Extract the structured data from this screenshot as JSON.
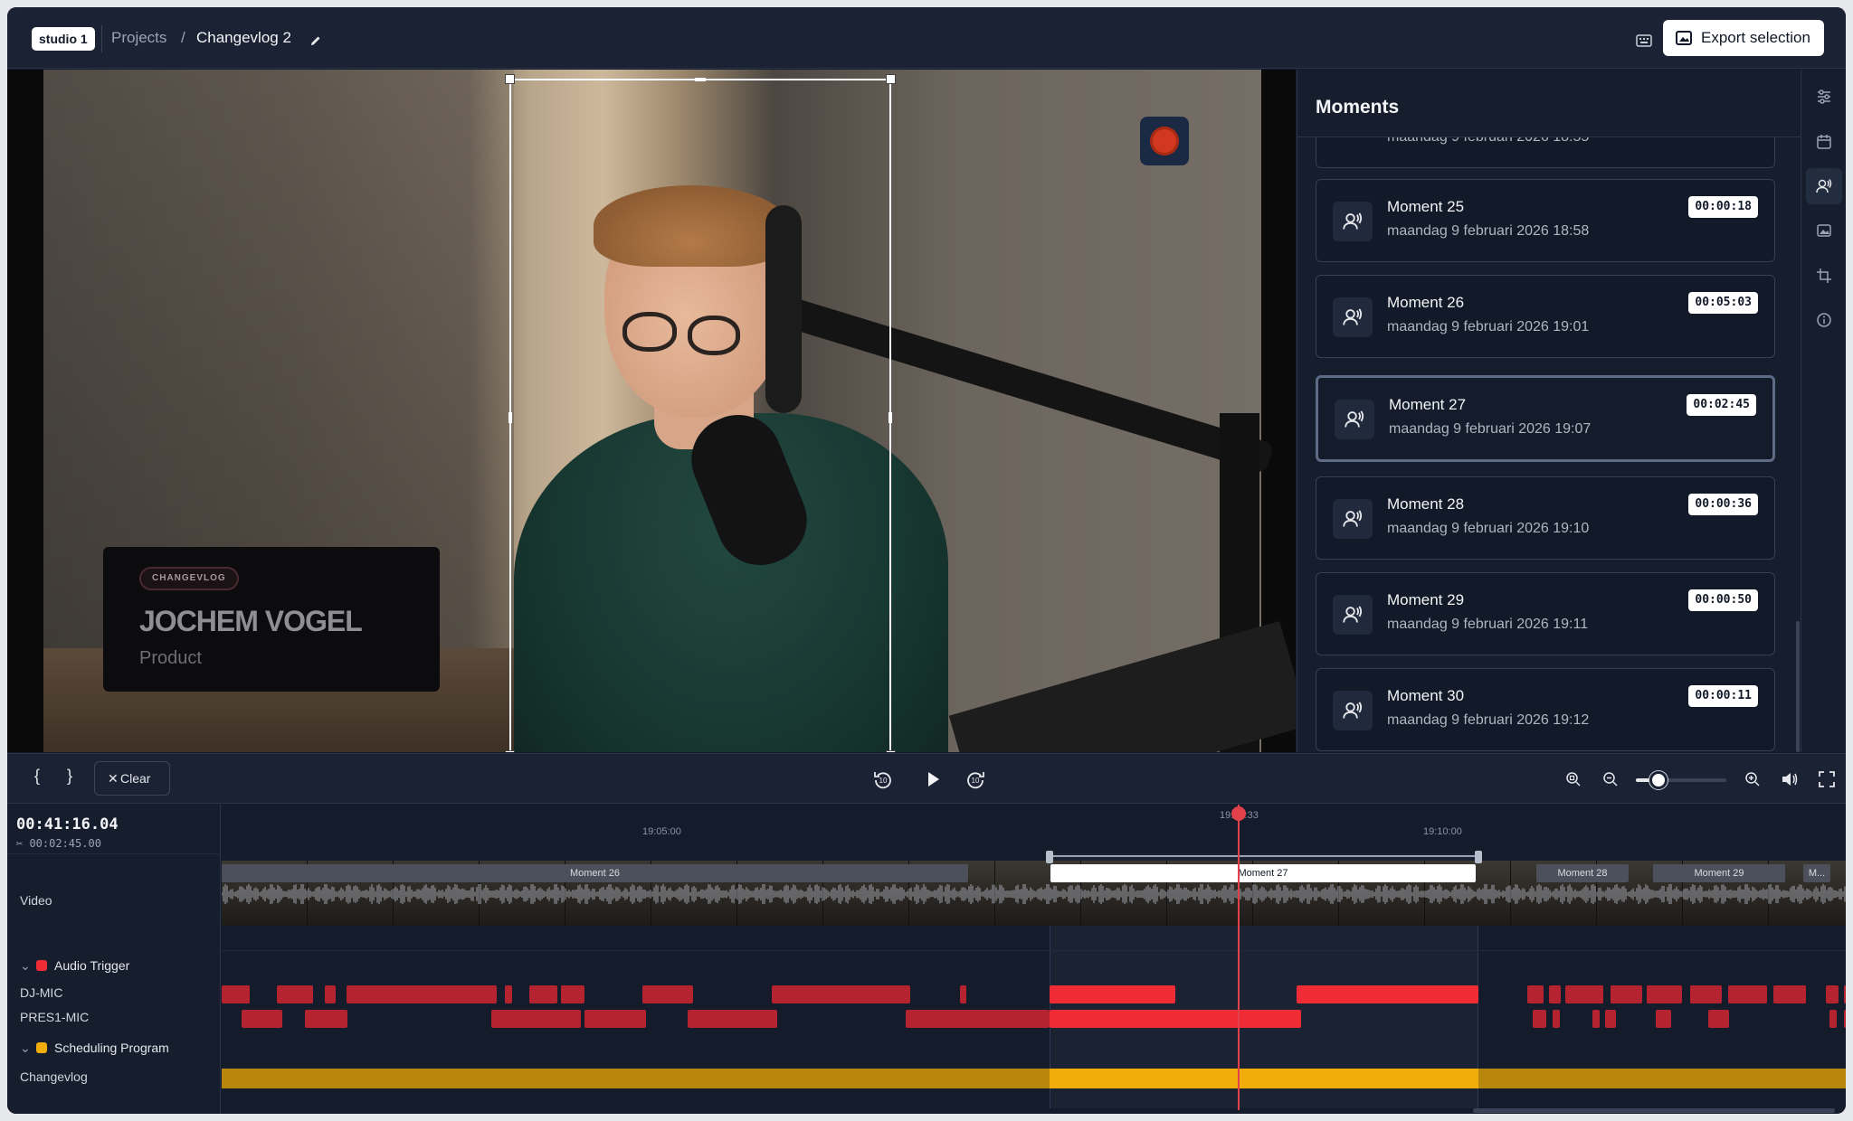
{
  "header": {
    "studio_badge": "studio 1",
    "breadcrumb_projects": "Projects",
    "breadcrumb_sep": "/",
    "breadcrumb_current": "Changevlog 2",
    "export_label": "Export selection"
  },
  "video": {
    "lower_third_tag": "CHANGEVLOG",
    "lower_third_name": "JOCHEM VOGEL",
    "lower_third_role": "Product"
  },
  "moments_panel": {
    "title": "Moments",
    "partial_top_date": "maandag 9 februari 2026 18:55",
    "items": [
      {
        "name": "Moment 25",
        "date": "maandag 9 februari 2026 18:58",
        "duration": "00:00:18",
        "selected": false
      },
      {
        "name": "Moment 26",
        "date": "maandag 9 februari 2026 19:01",
        "duration": "00:05:03",
        "selected": false
      },
      {
        "name": "Moment 27",
        "date": "maandag 9 februari 2026 19:07",
        "duration": "00:02:45",
        "selected": true
      },
      {
        "name": "Moment 28",
        "date": "maandag 9 februari 2026 19:10",
        "duration": "00:00:36",
        "selected": false
      },
      {
        "name": "Moment 29",
        "date": "maandag 9 februari 2026 19:11",
        "duration": "00:00:50",
        "selected": false
      },
      {
        "name": "Moment 30",
        "date": "maandag 9 februari 2026 19:12",
        "duration": "00:00:11",
        "selected": false
      }
    ]
  },
  "tool_rail": [
    "sliders-icon",
    "calendar-icon",
    "speaker-person-icon",
    "image-icon",
    "crop-icon",
    "info-icon"
  ],
  "transport": {
    "in_point": "{",
    "out_point": "}",
    "clear_label": "Clear",
    "zoom_level": 0.25
  },
  "timeline": {
    "timecode": "00:41:16.04",
    "selection_duration": "00:02:45.00",
    "ruler_labels": [
      "19:05:00",
      "19:08:33",
      "19:10:00"
    ],
    "video_track_label": "Video",
    "moment_tags": [
      "Moment 26",
      "Moment 27",
      "Moment 28",
      "Moment 29",
      "M..."
    ],
    "groups": [
      {
        "name": "Audio Trigger",
        "color": "#ef2b35",
        "tracks": [
          "DJ-MIC",
          "PRES1-MIC"
        ]
      },
      {
        "name": "Scheduling Program",
        "color": "#f0ad0c",
        "tracks": [
          "Changevlog"
        ]
      }
    ]
  },
  "colors": {
    "accent_red": "#ef2b35",
    "schedule_yellow": "#f0ad0c",
    "background": "#141b2b"
  }
}
